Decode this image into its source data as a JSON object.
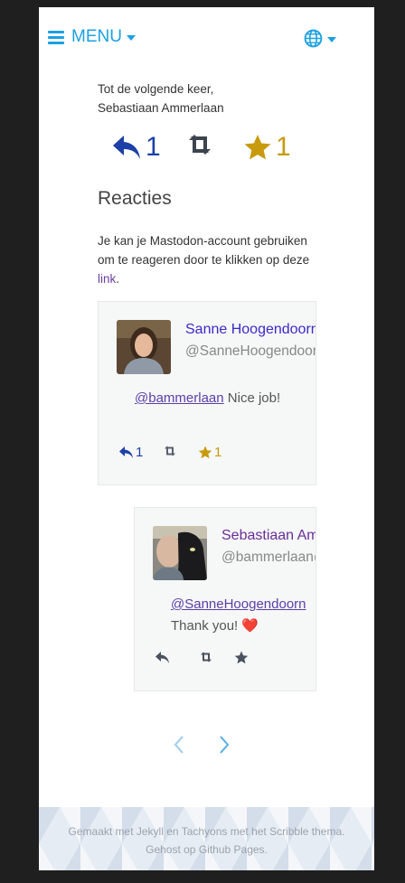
{
  "nav": {
    "menu_label": "MENU",
    "menu_icon": "hamburger-icon",
    "language_icon": "globe-icon"
  },
  "post": {
    "signoff_line1": "Tot de volgende keer,",
    "signoff_line2": "Sebastiaan Ammerlaan"
  },
  "post_stats": {
    "replies": "1",
    "boosts": "",
    "favourites": "1"
  },
  "reactions": {
    "title": "Reacties",
    "text": "Je kan je Mastodon-account gebruiken om te reageren door te klikken op deze ",
    "link_label": "link",
    "text_end": "."
  },
  "comments": [
    {
      "author_name": "Sanne Hoogendoorn",
      "author_handle": "@SanneHoogendoorn@mastodon.social",
      "mention": "@bammerlaan",
      "text": " Nice job!",
      "replies": "1",
      "boosts": "",
      "favourites": "1"
    },
    {
      "author_name": "Sebastiaan Ammerlaan",
      "author_handle": "@bammerlaan@mastodon.social",
      "mention": "@SanneHoogendoorn",
      "text": "Thank you! ❤️",
      "replies": "",
      "boosts": "",
      "favourites": ""
    }
  ],
  "pager": {
    "prev_icon": "chevron-left-icon",
    "next_icon": "chevron-right-icon"
  },
  "footer": {
    "line1_prefix": "Gemaakt met ",
    "jekyll": "Jekyll",
    "and": " en ",
    "tachyons": "Tachyons",
    "line1_mid": " met het ",
    "scribble": "Scribble",
    "line1_suffix": " thema.",
    "line2_prefix": "Gehost op ",
    "github_pages": "Github Pages",
    "line2_suffix": "."
  },
  "colors": {
    "accent": "#1ba1e2",
    "reply": "#1c3fa8",
    "favourite": "#c89a0e",
    "link": "#6a3fa0"
  }
}
